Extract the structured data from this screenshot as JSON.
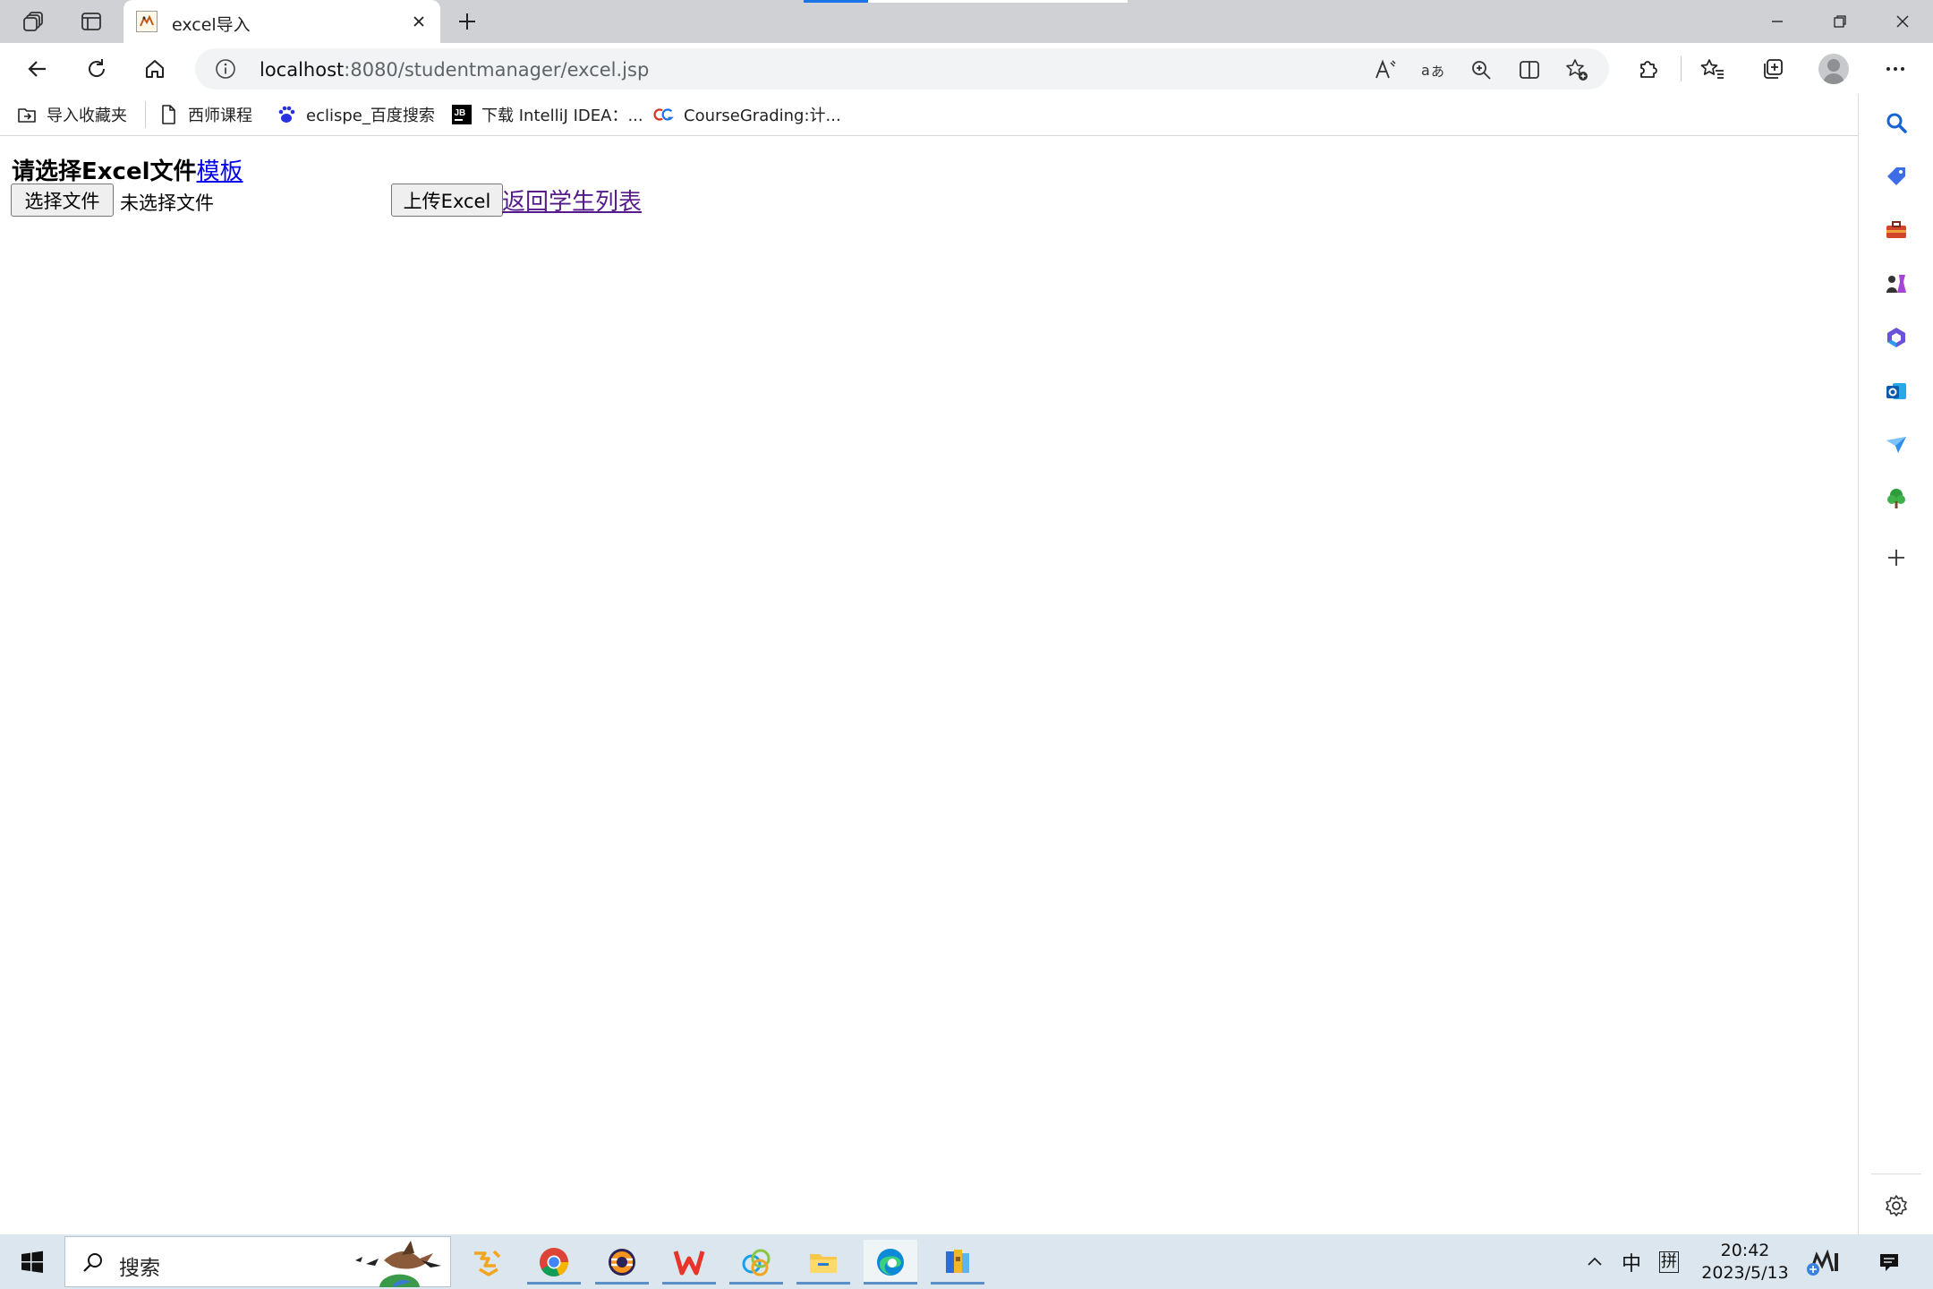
{
  "browser": {
    "tab": {
      "title": "excel导入"
    },
    "address": {
      "host": "localhost",
      "rest": ":8080/studentmanager/excel.jsp"
    }
  },
  "favorites": [
    {
      "label": "导入收藏夹",
      "icon": "import-favorites-icon"
    },
    {
      "label": "西师课程",
      "icon": "page-icon"
    },
    {
      "label": "eclispe_百度搜索",
      "icon": "baidu-paw-icon"
    },
    {
      "label": "下载 IntelliJ IDEA：...",
      "icon": "jetbrains-icon"
    },
    {
      "label": "CourseGrading:计...",
      "icon": "coursegrading-icon"
    }
  ],
  "page": {
    "heading": "请选择Excel文件",
    "template_link": "模板",
    "choose_file_button": "选择文件",
    "file_status": "未选择文件",
    "upload_button": "上传Excel",
    "back_link": "返回学生列表"
  },
  "taskbar": {
    "search_placeholder": "搜索",
    "ime_lang": "中",
    "ime_mode": "拼",
    "time": "20:42",
    "date": "2023/5/13"
  },
  "colors": {
    "link": "#0000ee",
    "visited_link": "#551a8b",
    "tabstrip": "#cfd1d4",
    "taskbar": "#dce6ee"
  }
}
